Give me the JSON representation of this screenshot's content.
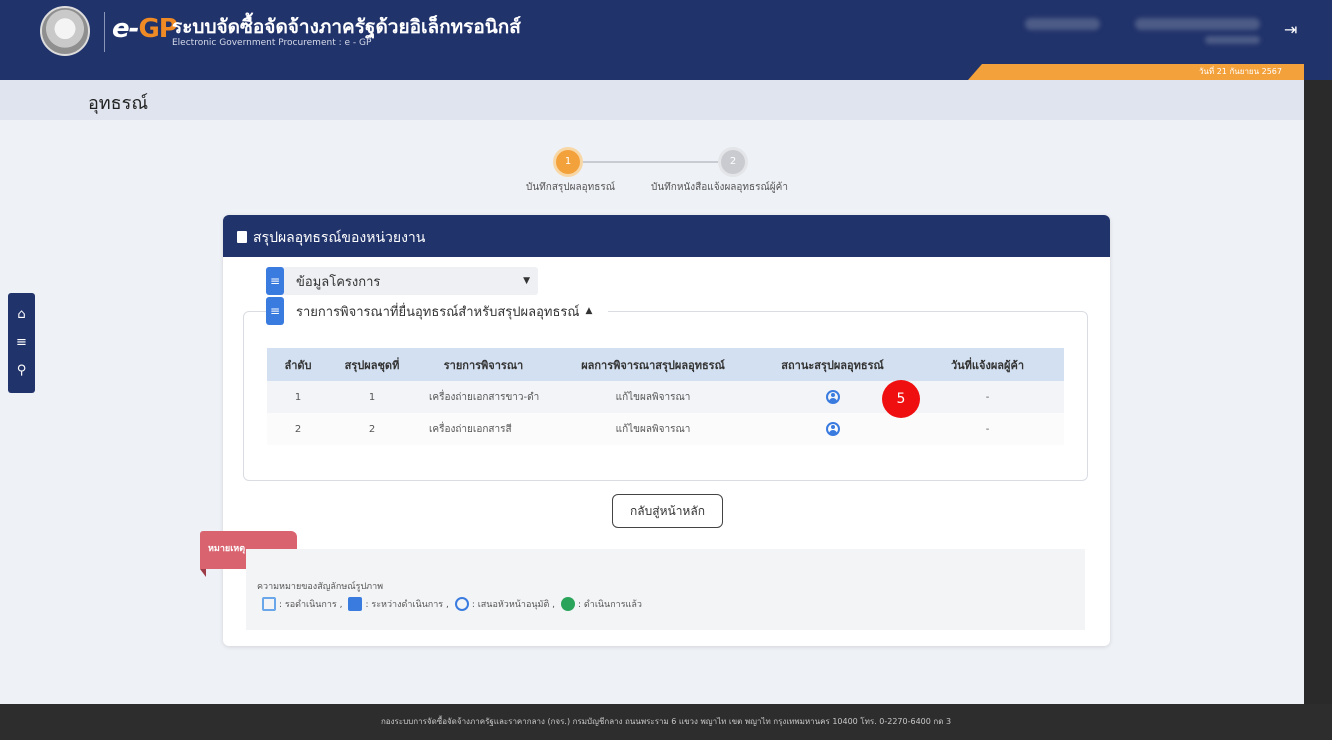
{
  "header": {
    "logo_e": "e-",
    "logo_gp": "GP",
    "title": "ระบบจัดซื้อจัดจ้างภาครัฐด้วยอิเล็กทรอนิกส์",
    "subtitle": "Electronic Government Procurement : e - GP",
    "date": "วันที่ 21 กันยายน 2567"
  },
  "page": {
    "title": "อุทธรณ์"
  },
  "stepper": [
    {
      "number": "1",
      "label": "บันทึกสรุปผลอุทธรณ์",
      "state": "active"
    },
    {
      "number": "2",
      "label": "บันทึกหนังสือแจ้งผลอุทธรณ์ผู้ค้า",
      "state": "inactive"
    }
  ],
  "card": {
    "title": "สรุปผลอุทธรณ์ของหน่วยงาน",
    "section1": "ข้อมูลโครงการ",
    "section2": "รายการพิจารณาที่ยื่นอุทธรณ์สำหรับสรุปผลอุทธรณ์"
  },
  "table": {
    "headers": [
      "ลำดับ",
      "สรุปผลชุดที่",
      "รายการพิจารณา",
      "ผลการพิจารณาสรุปผลอุทธรณ์",
      "สถานะสรุปผลอุทธรณ์",
      "วันที่แจ้งผลผู้ค้า"
    ],
    "rows": [
      {
        "no": "1",
        "set": "1",
        "item": "เครื่องถ่ายเอกสารขาว-ดำ",
        "result": "แก้ไขผลพิจารณา",
        "date": "-"
      },
      {
        "no": "2",
        "set": "2",
        "item": "เครื่องถ่ายเอกสารสี",
        "result": "แก้ไขผลพิจารณา",
        "date": "-"
      }
    ]
  },
  "badge": "5",
  "back_button": "กลับสู่หน้าหลัก",
  "legend": {
    "ribbon": "หมายเหตุ",
    "title": "ความหมายของสัญลักษณ์รูปภาพ",
    "items": [
      ": รอดำเนินการ ,",
      ": ระหว่างดำเนินการ ,",
      ": เสนอหัวหน้าอนุมัติ ,",
      ": ดำเนินการแล้ว"
    ]
  },
  "footer": "กองระบบการจัดซื้อจัดจ้างภาครัฐและราคากลาง (กจร.) กรมบัญชีกลาง ถนนพระราม 6 แขวง พญาไท เขต พญาไท กรุงเทพมหานคร 10400 โทร. 0-2270-6400 กด 3",
  "colors": {
    "navy": "#21336b",
    "orange": "#f3a13a",
    "blue": "#3a7be0",
    "red": "#ef0f10"
  }
}
